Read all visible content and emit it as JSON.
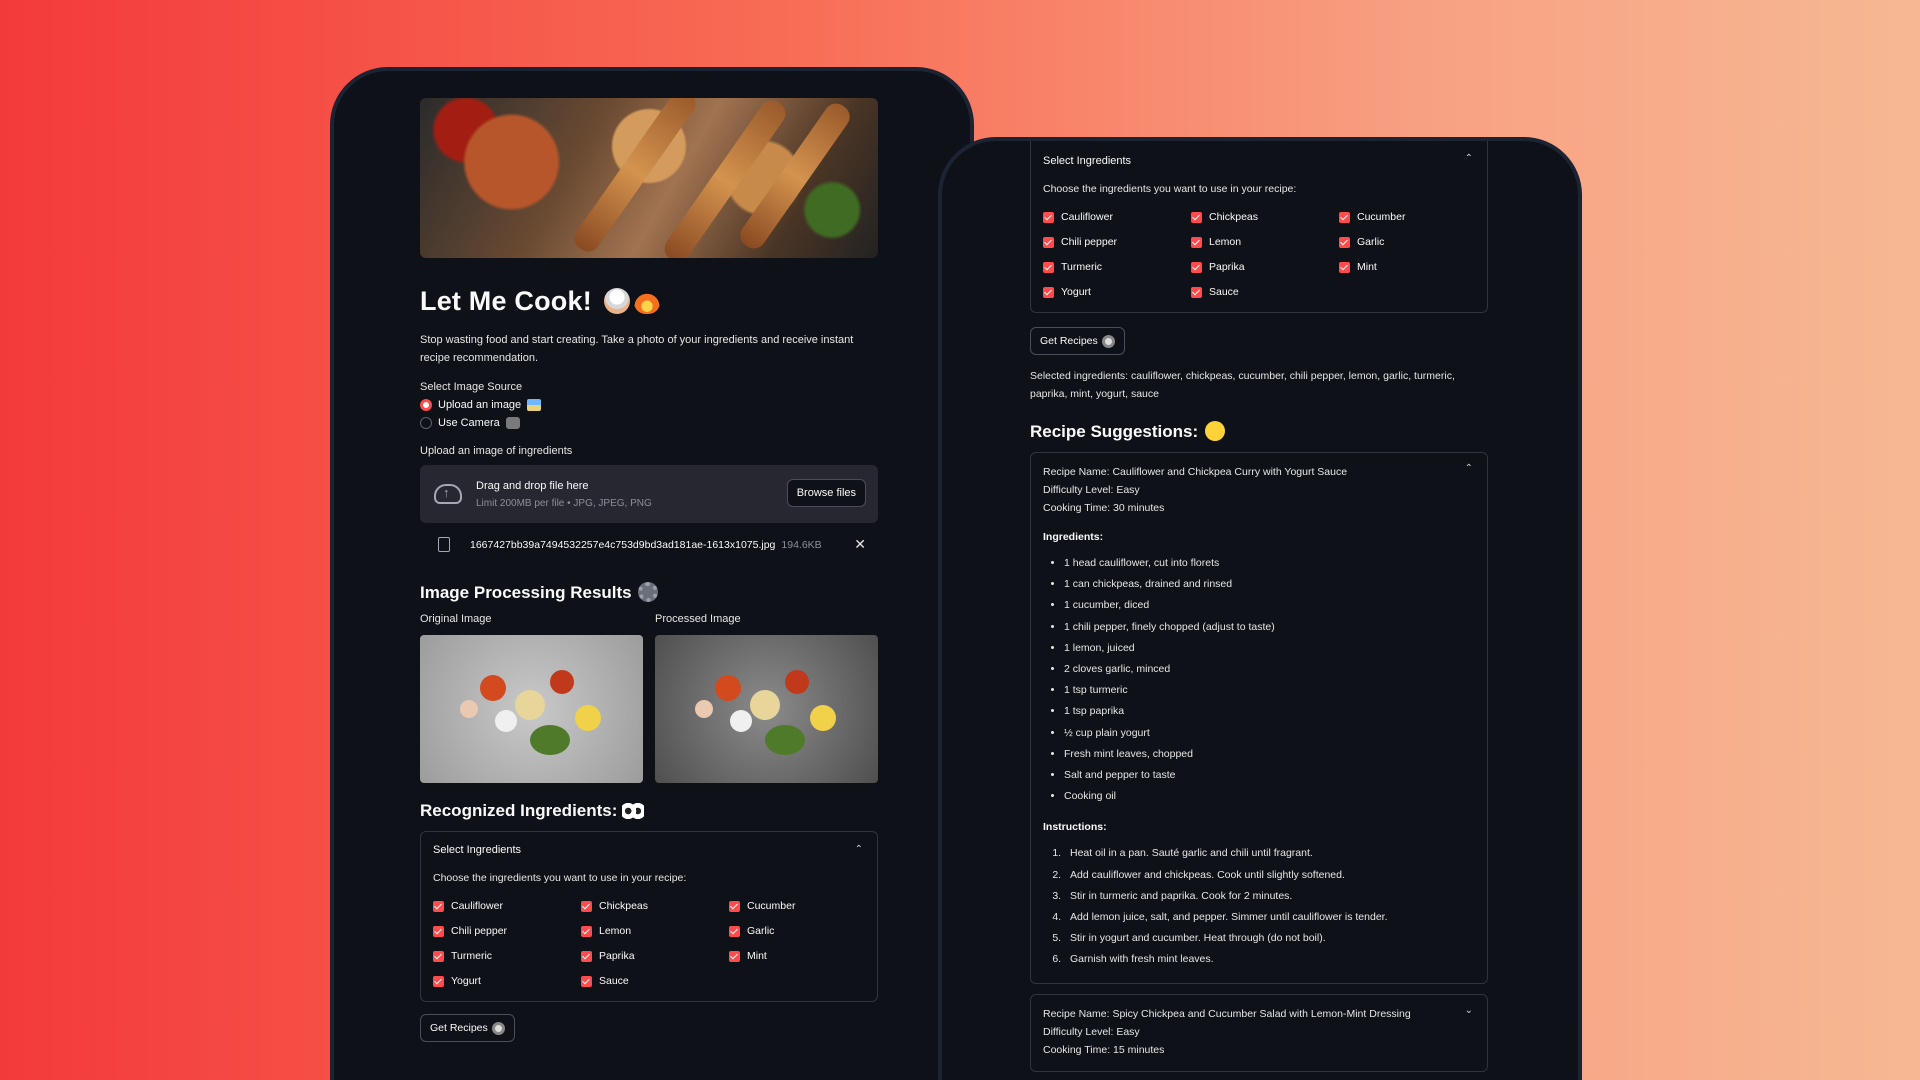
{
  "left": {
    "title": "Let Me Cook!",
    "description": "Stop wasting food and start creating. Take a photo of your ingredients and receive instant recipe recommendation.",
    "image_source_label": "Select Image Source",
    "radio_options": [
      "Upload an image",
      "Use Camera"
    ],
    "upload_label": "Upload an image of ingredients",
    "dropzone_title": "Drag and drop file here",
    "dropzone_limit": "Limit 200MB per file • JPG, JPEG, PNG",
    "browse_label": "Browse files",
    "file_name": "1667427bb39a7494532257e4c753d9bd3ad181ae-1613x1075.jpg",
    "file_size": "194.6KB",
    "close_glyph": "✕",
    "processing_heading": "Image Processing Results",
    "original_caption": "Original Image",
    "processed_caption": "Processed Image",
    "recognized_heading": "Recognized Ingredients:",
    "get_recipes_label": "Get Recipes"
  },
  "ingredients_box": {
    "header": "Select Ingredients",
    "subtitle": "Choose the ingredients you want to use in your recipe:",
    "items": [
      "Cauliflower",
      "Chickpeas",
      "Cucumber",
      "Chili pepper",
      "Lemon",
      "Garlic",
      "Turmeric",
      "Paprika",
      "Mint",
      "Yogurt",
      "Sauce"
    ]
  },
  "right": {
    "get_recipes_label": "Get Recipes",
    "selected_text": "Selected ingredients: cauliflower, chickpeas, cucumber, chili pepper, lemon, garlic, turmeric, paprika, mint, yogurt, sauce",
    "suggestions_heading": "Recipe Suggestions:",
    "recipe1": {
      "name": "Recipe Name: Cauliflower and Chickpea Curry with Yogurt Sauce",
      "difficulty": "Difficulty Level: Easy",
      "time": "Cooking Time: 30 minutes",
      "ingredients_heading": "Ingredients:",
      "ingredients": [
        "1 head cauliflower, cut into florets",
        "1 can chickpeas, drained and rinsed",
        "1 cucumber, diced",
        "1 chili pepper, finely chopped (adjust to taste)",
        "1 lemon, juiced",
        "2 cloves garlic, minced",
        "1 tsp turmeric",
        "1 tsp paprika",
        "½ cup plain yogurt",
        "Fresh mint leaves, chopped",
        "Salt and pepper to taste",
        "Cooking oil"
      ],
      "instructions_heading": "Instructions:",
      "instructions": [
        "Heat oil in a pan. Sauté garlic and chili until fragrant.",
        "Add cauliflower and chickpeas. Cook until slightly softened.",
        "Stir in turmeric and paprika. Cook for 2 minutes.",
        "Add lemon juice, salt, and pepper. Simmer until cauliflower is tender.",
        "Stir in yogurt and cucumber. Heat through (do not boil).",
        "Garnish with fresh mint leaves."
      ]
    },
    "recipe2": {
      "name": "Recipe Name: Spicy Chickpea and Cucumber Salad with Lemon-Mint Dressing",
      "difficulty": "Difficulty Level: Easy",
      "time": "Cooking Time: 15 minutes"
    }
  },
  "glyphs": {
    "chevron_up": "⌃",
    "chevron_down": "⌄"
  },
  "colors": {
    "accent": "#ff4b4b",
    "app_bg": "#0e1117",
    "surface": "#262730"
  }
}
